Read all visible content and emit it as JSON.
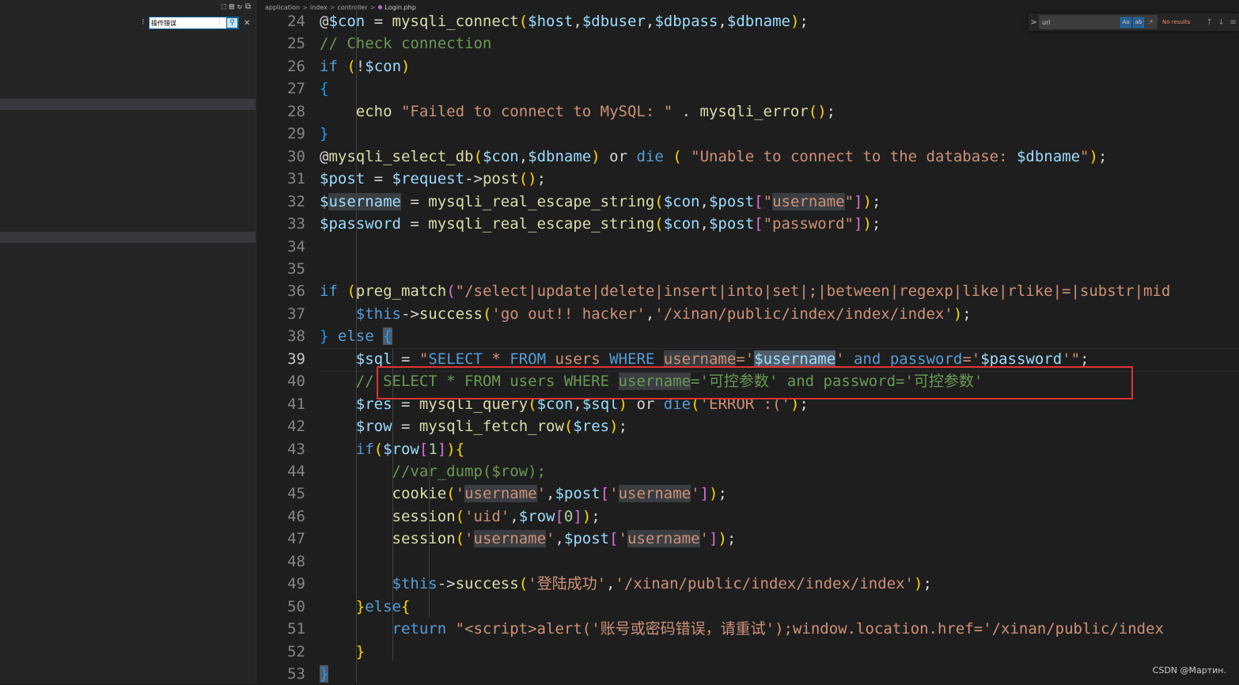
{
  "sidebar": {
    "search_value": "操作错误",
    "toolbar_icons": [
      "new-file-icon",
      "new-folder-icon",
      "refresh-icon",
      "collapse-all-icon"
    ]
  },
  "breadcrumb": {
    "items": [
      "application",
      "index",
      "controller"
    ],
    "file": "Login.php",
    "separator": ">"
  },
  "find": {
    "query": "url",
    "results": "No results",
    "opt_case": "Aa",
    "opt_word": "ab",
    "opt_regex": ".*",
    "prev": "↑",
    "next": "↓",
    "menu": "≡",
    "toggle": ">"
  },
  "watermark": "CSDN @Мартин.",
  "editor": {
    "current_line": 39,
    "lines": [
      {
        "num": "24",
        "tokens": [
          [
            "pn",
            "@"
          ],
          [
            "v",
            "$con"
          ],
          [
            "pn",
            " = "
          ],
          [
            "f",
            "mysqli_connect"
          ],
          [
            "b1",
            "("
          ],
          [
            "v",
            "$host"
          ],
          [
            "pn",
            ","
          ],
          [
            "v",
            "$dbuser"
          ],
          [
            "pn",
            ","
          ],
          [
            "v",
            "$dbpass"
          ],
          [
            "pn",
            ","
          ],
          [
            "v",
            "$dbname"
          ],
          [
            "b1",
            ")"
          ],
          [
            "pn",
            ";"
          ]
        ]
      },
      {
        "num": "25",
        "tokens": [
          [
            "cm",
            "// Check connection"
          ]
        ]
      },
      {
        "num": "26",
        "tokens": [
          [
            "k",
            "if"
          ],
          [
            "pn",
            " "
          ],
          [
            "b1",
            "("
          ],
          [
            "pn",
            "!"
          ],
          [
            "v",
            "$con"
          ],
          [
            "b1",
            ")"
          ]
        ]
      },
      {
        "num": "27",
        "tokens": [
          [
            "b3",
            "{"
          ]
        ]
      },
      {
        "num": "28",
        "tokens": [
          [
            "pn",
            "    "
          ],
          [
            "f",
            "echo"
          ],
          [
            "pn",
            " "
          ],
          [
            "s",
            "\"Failed to connect to MySQL: \""
          ],
          [
            "pn",
            " . "
          ],
          [
            "f",
            "mysqli_error"
          ],
          [
            "b1",
            "()"
          ],
          [
            "pn",
            ";"
          ]
        ]
      },
      {
        "num": "29",
        "tokens": [
          [
            "b3",
            "}"
          ]
        ]
      },
      {
        "num": "30",
        "tokens": [
          [
            "pn",
            "@"
          ],
          [
            "f",
            "mysqli_select_db"
          ],
          [
            "b1",
            "("
          ],
          [
            "v",
            "$con"
          ],
          [
            "pn",
            ","
          ],
          [
            "v",
            "$dbname"
          ],
          [
            "b1",
            ")"
          ],
          [
            "pn",
            " or "
          ],
          [
            "k",
            "die"
          ],
          [
            "pn",
            " "
          ],
          [
            "b1",
            "("
          ],
          [
            "pn",
            " "
          ],
          [
            "s",
            "\"Unable to connect to the database: "
          ],
          [
            "v",
            "$dbname"
          ],
          [
            "s",
            "\""
          ],
          [
            "b1",
            ")"
          ],
          [
            "pn",
            ";"
          ]
        ]
      },
      {
        "num": "31",
        "tokens": [
          [
            "v",
            "$post"
          ],
          [
            "pn",
            " = "
          ],
          [
            "v",
            "$request"
          ],
          [
            "pn",
            "->"
          ],
          [
            "f",
            "post"
          ],
          [
            "b1",
            "()"
          ],
          [
            "pn",
            ";"
          ]
        ]
      },
      {
        "num": "32",
        "tokens": [
          [
            "v",
            "$"
          ],
          [
            "v hl",
            "username"
          ],
          [
            "pn",
            " = "
          ],
          [
            "f",
            "mysqli_real_escape_string"
          ],
          [
            "b1",
            "("
          ],
          [
            "v",
            "$con"
          ],
          [
            "pn",
            ","
          ],
          [
            "v",
            "$post"
          ],
          [
            "b2",
            "["
          ],
          [
            "s",
            "\""
          ],
          [
            "s hl",
            "username"
          ],
          [
            "s",
            "\""
          ],
          [
            "b2",
            "]"
          ],
          [
            "b1",
            ")"
          ],
          [
            "pn",
            ";"
          ]
        ]
      },
      {
        "num": "33",
        "tokens": [
          [
            "v",
            "$password"
          ],
          [
            "pn",
            " = "
          ],
          [
            "f",
            "mysqli_real_escape_string"
          ],
          [
            "b1",
            "("
          ],
          [
            "v",
            "$con"
          ],
          [
            "pn",
            ","
          ],
          [
            "v",
            "$post"
          ],
          [
            "b2",
            "["
          ],
          [
            "s",
            "\"password\""
          ],
          [
            "b2",
            "]"
          ],
          [
            "b1",
            ")"
          ],
          [
            "pn",
            ";"
          ]
        ]
      },
      {
        "num": "34",
        "tokens": []
      },
      {
        "num": "35",
        "tokens": []
      },
      {
        "num": "36",
        "tokens": [
          [
            "k",
            "if"
          ],
          [
            "pn",
            " "
          ],
          [
            "b1",
            "("
          ],
          [
            "f",
            "preg_match"
          ],
          [
            "b2",
            "("
          ],
          [
            "s",
            "\"/select|update|delete|insert|into|set|;|between|regexp|like|rlike|=|substr|mid"
          ]
        ]
      },
      {
        "num": "37",
        "tokens": [
          [
            "pn",
            "    "
          ],
          [
            "c",
            "$this"
          ],
          [
            "pn",
            "->"
          ],
          [
            "f",
            "success"
          ],
          [
            "b1",
            "("
          ],
          [
            "s",
            "'go out!! hacker'"
          ],
          [
            "pn",
            ","
          ],
          [
            "s",
            "'/xinan/public/index/index/index'"
          ],
          [
            "b1",
            ")"
          ],
          [
            "pn",
            ";"
          ]
        ]
      },
      {
        "num": "38",
        "tokens": [
          [
            "b3",
            "}"
          ],
          [
            "pn",
            " "
          ],
          [
            "k",
            "else"
          ],
          [
            "pn",
            " "
          ],
          [
            "b3 hl2",
            "{"
          ]
        ]
      },
      {
        "num": "39",
        "tokens": [
          [
            "pn",
            "    "
          ],
          [
            "v",
            "$sql"
          ],
          [
            "pn",
            " = "
          ],
          [
            "s",
            "\""
          ],
          [
            "c",
            "SELECT"
          ],
          [
            "s",
            " * "
          ],
          [
            "c",
            "FROM"
          ],
          [
            "s",
            " users "
          ],
          [
            "c",
            "WHERE"
          ],
          [
            "s",
            " "
          ],
          [
            "s hl",
            "username"
          ],
          [
            "s",
            "='"
          ],
          [
            "v hl2",
            "$username"
          ],
          [
            "s",
            "' "
          ],
          [
            "c",
            "and"
          ],
          [
            "s",
            " "
          ],
          [
            "c",
            "password"
          ],
          [
            "s",
            "='"
          ],
          [
            "v",
            "$password"
          ],
          [
            "s",
            "'\""
          ],
          [
            "pn",
            ";"
          ]
        ]
      },
      {
        "num": "40",
        "tokens": [
          [
            "pn",
            "    "
          ],
          [
            "cm",
            "// SELECT * FROM users WHERE "
          ],
          [
            "cm hl",
            "username"
          ],
          [
            "cm",
            "='可控参数' and password='可控参数'"
          ]
        ]
      },
      {
        "num": "41",
        "tokens": [
          [
            "pn",
            "    "
          ],
          [
            "v",
            "$res"
          ],
          [
            "pn",
            " = "
          ],
          [
            "f",
            "mysqli_query"
          ],
          [
            "b1",
            "("
          ],
          [
            "v",
            "$con"
          ],
          [
            "pn",
            ","
          ],
          [
            "v",
            "$sql"
          ],
          [
            "b1",
            ")"
          ],
          [
            "pn",
            " or "
          ],
          [
            "k",
            "die"
          ],
          [
            "b1",
            "("
          ],
          [
            "s",
            "'ERROR :('"
          ],
          [
            "b1",
            ")"
          ],
          [
            "pn",
            ";"
          ]
        ]
      },
      {
        "num": "42",
        "tokens": [
          [
            "pn",
            "    "
          ],
          [
            "v",
            "$row"
          ],
          [
            "pn",
            " = "
          ],
          [
            "f",
            "mysqli_fetch_row"
          ],
          [
            "b1",
            "("
          ],
          [
            "v",
            "$res"
          ],
          [
            "b1",
            ")"
          ],
          [
            "pn",
            ";"
          ]
        ]
      },
      {
        "num": "43",
        "tokens": [
          [
            "pn",
            "    "
          ],
          [
            "k",
            "if"
          ],
          [
            "b1",
            "("
          ],
          [
            "v",
            "$row"
          ],
          [
            "b2",
            "["
          ],
          [
            "n",
            "1"
          ],
          [
            "b2",
            "]"
          ],
          [
            "b1",
            ")"
          ],
          [
            "b1",
            "{"
          ]
        ]
      },
      {
        "num": "44",
        "tokens": [
          [
            "pn",
            "        "
          ],
          [
            "cm",
            "//var_dump($row);"
          ]
        ]
      },
      {
        "num": "45",
        "tokens": [
          [
            "pn",
            "        "
          ],
          [
            "f",
            "cookie"
          ],
          [
            "b1",
            "("
          ],
          [
            "s",
            "'"
          ],
          [
            "s hl",
            "username"
          ],
          [
            "s",
            "'"
          ],
          [
            "pn",
            ","
          ],
          [
            "v",
            "$post"
          ],
          [
            "b2",
            "["
          ],
          [
            "s",
            "'"
          ],
          [
            "s hl",
            "username"
          ],
          [
            "s",
            "'"
          ],
          [
            "b2",
            "]"
          ],
          [
            "b1",
            ")"
          ],
          [
            "pn",
            ";"
          ]
        ]
      },
      {
        "num": "46",
        "tokens": [
          [
            "pn",
            "        "
          ],
          [
            "f",
            "session"
          ],
          [
            "b1",
            "("
          ],
          [
            "s",
            "'uid'"
          ],
          [
            "pn",
            ","
          ],
          [
            "v",
            "$row"
          ],
          [
            "b2",
            "["
          ],
          [
            "n",
            "0"
          ],
          [
            "b2",
            "]"
          ],
          [
            "b1",
            ")"
          ],
          [
            "pn",
            ";"
          ]
        ]
      },
      {
        "num": "47",
        "tokens": [
          [
            "pn",
            "        "
          ],
          [
            "f",
            "session"
          ],
          [
            "b1",
            "("
          ],
          [
            "s",
            "'"
          ],
          [
            "s hl",
            "username"
          ],
          [
            "s",
            "'"
          ],
          [
            "pn",
            ","
          ],
          [
            "v",
            "$post"
          ],
          [
            "b2",
            "["
          ],
          [
            "s",
            "'"
          ],
          [
            "s hl",
            "username"
          ],
          [
            "s",
            "'"
          ],
          [
            "b2",
            "]"
          ],
          [
            "b1",
            ")"
          ],
          [
            "pn",
            ";"
          ]
        ]
      },
      {
        "num": "48",
        "tokens": []
      },
      {
        "num": "49",
        "tokens": [
          [
            "pn",
            "        "
          ],
          [
            "c",
            "$this"
          ],
          [
            "pn",
            "->"
          ],
          [
            "f",
            "success"
          ],
          [
            "b1",
            "("
          ],
          [
            "s",
            "'登陆成功'"
          ],
          [
            "pn",
            ","
          ],
          [
            "s",
            "'/xinan/public/index/index/index'"
          ],
          [
            "b1",
            ")"
          ],
          [
            "pn",
            ";"
          ]
        ]
      },
      {
        "num": "50",
        "tokens": [
          [
            "pn",
            "    "
          ],
          [
            "b1",
            "}"
          ],
          [
            "k",
            "else"
          ],
          [
            "b1",
            "{"
          ]
        ]
      },
      {
        "num": "51",
        "tokens": [
          [
            "pn",
            "        "
          ],
          [
            "k",
            "return"
          ],
          [
            "pn",
            " "
          ],
          [
            "s",
            "\"<script>alert('账号或密码错误，请重试');window.location.href='/xinan/public/index"
          ]
        ]
      },
      {
        "num": "52",
        "tokens": [
          [
            "pn",
            "    "
          ],
          [
            "b1",
            "}"
          ]
        ]
      },
      {
        "num": "53",
        "tokens": [
          [
            "b3 hl2",
            "}"
          ]
        ]
      }
    ]
  }
}
